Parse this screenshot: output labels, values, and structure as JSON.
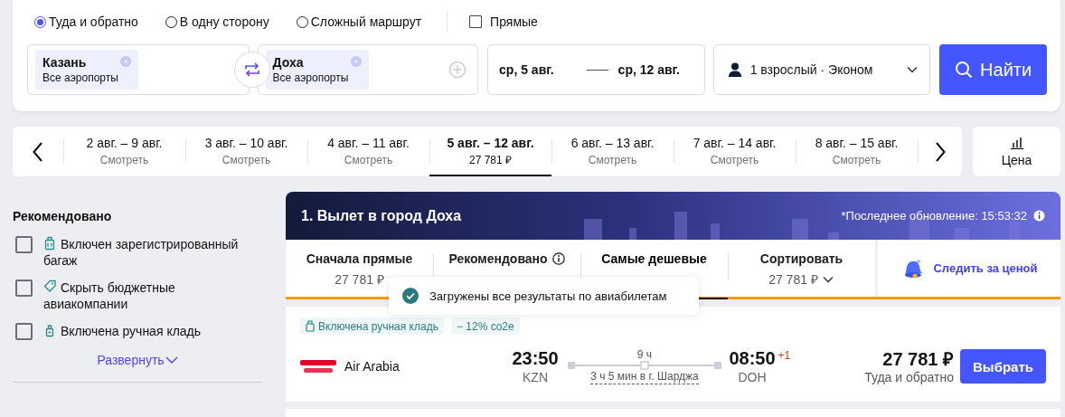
{
  "trip_types": [
    {
      "label": "Туда и обратно",
      "selected": true
    },
    {
      "label": "В одну сторону",
      "selected": false
    },
    {
      "label": "Сложный маршрут",
      "selected": false
    }
  ],
  "direct_only": {
    "label": "Прямые",
    "checked": false
  },
  "origin": {
    "city": "Казань",
    "airports": "Все аэропорты"
  },
  "destination": {
    "city": "Доха",
    "airports": "Все аэропорты"
  },
  "dates": {
    "depart": "ср, 5 авг.",
    "return": "ср, 12 авг."
  },
  "passengers": "1 взрослый · Эконом",
  "search_button": "Найти",
  "date_options": [
    {
      "range": "2 авг. – 9 авг.",
      "sub": "Смотреть",
      "selected": false
    },
    {
      "range": "3 авг. – 10 авг.",
      "sub": "Смотреть",
      "selected": false
    },
    {
      "range": "4 авг. – 11 авг.",
      "sub": "Смотреть",
      "selected": false
    },
    {
      "range": "5 авг. – 12 авг.",
      "sub": "27 781 ₽",
      "selected": true
    },
    {
      "range": "6 авг. – 13 авг.",
      "sub": "Смотреть",
      "selected": false
    },
    {
      "range": "7 авг. – 14 авг.",
      "sub": "Смотреть",
      "selected": false
    },
    {
      "range": "8 авг. – 15 авг.",
      "sub": "Смотреть",
      "selected": false
    }
  ],
  "price_chart_button": "Цена",
  "filters": {
    "title": "Рекомендовано",
    "items": [
      {
        "label": "Включен зарегистрированный багаж",
        "checked": false
      },
      {
        "label": "Скрыть бюджетные авиакомпании",
        "checked": false
      },
      {
        "label": "Включена ручная кладь",
        "checked": false
      }
    ],
    "expand": "Развернуть"
  },
  "results": {
    "title": "1. Вылет в город Доха",
    "updated": "*Последнее обновление: 15:53:32",
    "sort_tabs": [
      {
        "label": "Сначала прямые",
        "price": "27 781 ₽",
        "kind": "plain",
        "selected": false
      },
      {
        "label": "Рекомендовано",
        "kind": "info",
        "selected": false
      },
      {
        "label": "Самые дешевые",
        "kind": "plain",
        "selected": true
      },
      {
        "label": "Сортировать",
        "price": "27 781 ₽",
        "kind": "dropdown",
        "selected": false
      }
    ],
    "watch": "Следить за ценой",
    "toast": "Загружены все результаты по авиабилетам",
    "tickets": [
      {
        "tags": [
          "Включена ручная кладь",
          "− 12% co2e"
        ],
        "airline": "Air Arabia",
        "depart_time": "23:50",
        "depart_airport": "KZN",
        "duration": "9 ч",
        "stop": "3 ч 5 мин в г. Шарджа",
        "arrive_time": "08:50",
        "day_offset": "+1",
        "arrive_airport": "DOH",
        "price": "27 781 ₽",
        "price_note": "Туда и обратно",
        "button": "Выбрать"
      }
    ]
  }
}
